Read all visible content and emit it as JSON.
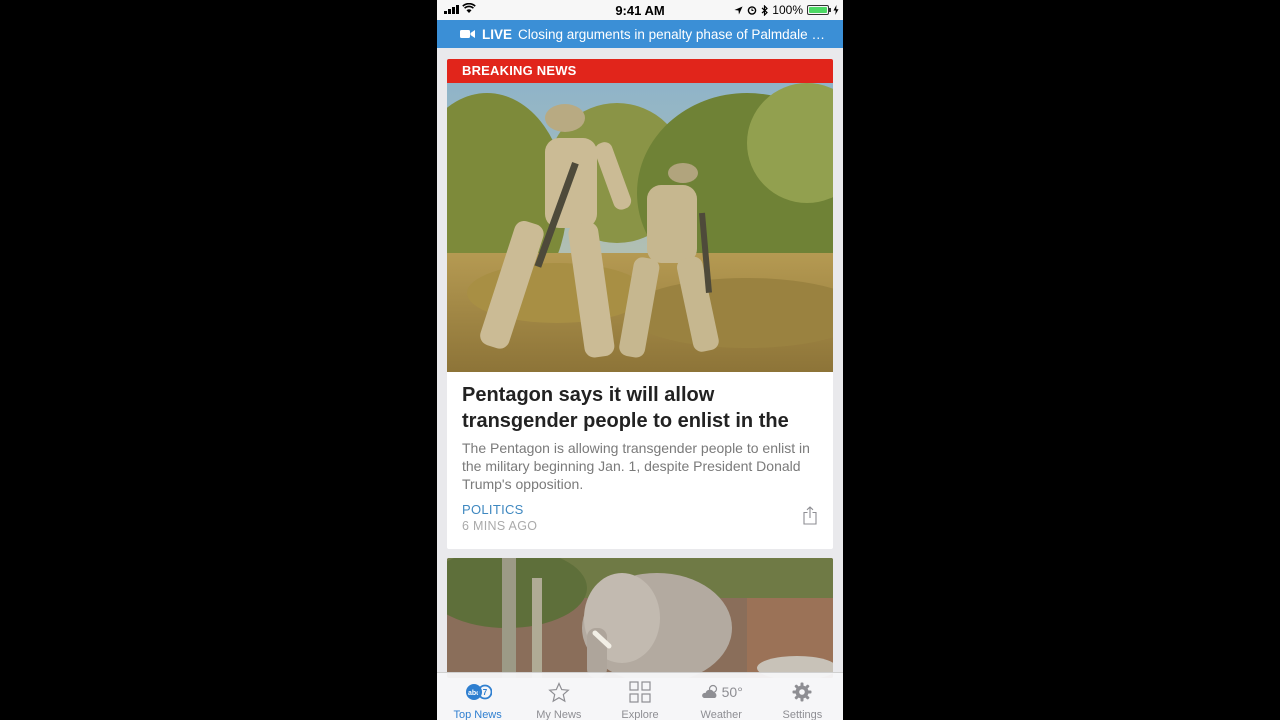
{
  "status_bar": {
    "time": "9:41 AM",
    "battery": "100%"
  },
  "live_banner": {
    "label": "LIVE",
    "headline": "Closing arguments in penalty phase of Palmdale a..."
  },
  "featured_story": {
    "badge": "BREAKING NEWS",
    "title": "Pentagon says it will allow transgender people to enlist in the military beginni...",
    "description": "The Pentagon is allowing transgender people to enlist in the military beginning Jan. 1, despite President Donald Trump's opposition.",
    "category": "POLITICS",
    "time_ago": "6 MINS AGO"
  },
  "tabs": [
    {
      "label": "Top News",
      "icon": "abc7-logo-icon",
      "active": true
    },
    {
      "label": "My News",
      "icon": "star-icon"
    },
    {
      "label": "Explore",
      "icon": "grid-icon"
    },
    {
      "label": "Weather",
      "icon": "weather-icon",
      "temp": "50°"
    },
    {
      "label": "Settings",
      "icon": "gear-icon"
    }
  ],
  "colors": {
    "accent": "#3b8fd6",
    "breaking": "#e1251b",
    "category": "#3f88c0",
    "tab_active": "#2f7fd0"
  }
}
